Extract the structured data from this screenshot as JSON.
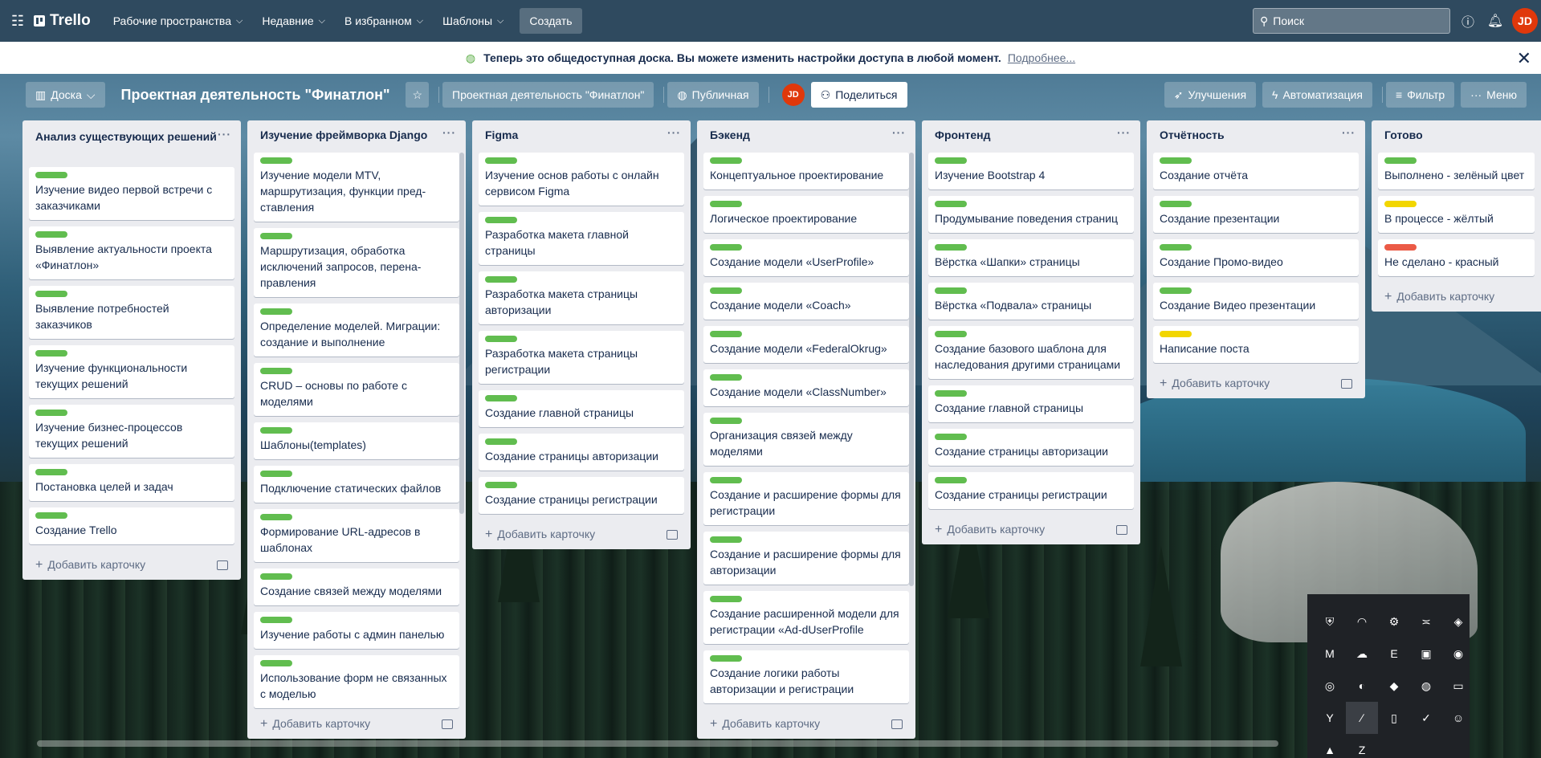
{
  "topnav": {
    "logo": "Trello",
    "menus": [
      "Рабочие пространства",
      "Недавние",
      "В избранном",
      "Шаблоны"
    ],
    "create": "Создать",
    "search_placeholder": "Поиск",
    "avatar": "JD"
  },
  "banner": {
    "text": "Теперь это общедоступная доска. Вы можете изменить настройки доступа в любой момент.",
    "link": "Подробнее..."
  },
  "board": {
    "view": "Доска",
    "title": "Проектная деятельность \"Финатлон\"",
    "workspace": "Проектная деятельность \"Финатлон\"",
    "visibility": "Публичная",
    "avatar": "JD",
    "share": "Поделиться",
    "powerups": "Улучшения",
    "automation": "Автоматизация",
    "filter": "Фильтр",
    "menu": "Меню"
  },
  "add_card": "Добавить карточку",
  "colors": {
    "green": "#61bd4f",
    "yellow": "#f2d600",
    "red": "#eb5a46",
    "brand_red": "#e0380b"
  },
  "lists": [
    {
      "title": "Анализ существующих решений",
      "cards": [
        {
          "text": "Изучение видео первой встречи с заказчиками",
          "label": "green"
        },
        {
          "text": "Выявление актуальности проекта «Финатлон»",
          "label": "green"
        },
        {
          "text": "Выявление потребностей заказчиков",
          "label": "green"
        },
        {
          "text": "Изучение функциональности текущих решений",
          "label": "green"
        },
        {
          "text": "Изучение бизнес-процессов текущих решений",
          "label": "green"
        },
        {
          "text": "Постановка целей и задач",
          "label": "green"
        },
        {
          "text": "Создание Trello",
          "label": "green"
        }
      ]
    },
    {
      "title": "Изучение фреймворка Django",
      "cards": [
        {
          "text": "Изучение модели MTV, маршрутизация, функции пред-ставления",
          "label": "green"
        },
        {
          "text": "Маршрутизация, обработка исключений запросов, перена-правления",
          "label": "green"
        },
        {
          "text": "Определение моделей. Миграции: создание и выполнение",
          "label": "green"
        },
        {
          "text": "CRUD – основы по работе с моделями",
          "label": "green"
        },
        {
          "text": "Шаблоны(templates)",
          "label": "green"
        },
        {
          "text": "Подключение статических файлов",
          "label": "green"
        },
        {
          "text": "Формирование URL-адресов в шаблонах",
          "label": "green"
        },
        {
          "text": "Создание связей между моделями",
          "label": "green"
        },
        {
          "text": "Изучение работы с админ панелью",
          "label": "green"
        },
        {
          "text": "Использование форм не связанных с моделью",
          "label": "green"
        },
        {
          "text": "",
          "label": "green"
        }
      ]
    },
    {
      "title": "Figma",
      "cards": [
        {
          "text": "Изучение основ работы с онлайн сервисом Figma",
          "label": "green"
        },
        {
          "text": "Разработка макета главной страницы",
          "label": "green"
        },
        {
          "text": "Разработка макета страницы авторизации",
          "label": "green"
        },
        {
          "text": "Разработка макета страницы регистрации",
          "label": "green"
        },
        {
          "text": "Создание главной страницы",
          "label": "green"
        },
        {
          "text": "Создание страницы авторизации",
          "label": "green"
        },
        {
          "text": "Создание страницы регистрации",
          "label": "green"
        }
      ]
    },
    {
      "title": "Бэкенд",
      "cards": [
        {
          "text": "Концептуальное проектирование",
          "label": "green"
        },
        {
          "text": "Логическое проектирование",
          "label": "green"
        },
        {
          "text": "Создание модели «UserProfile»",
          "label": "green"
        },
        {
          "text": "Создание модели «Coach»",
          "label": "green"
        },
        {
          "text": "Создание модели «FederalOkrug»",
          "label": "green"
        },
        {
          "text": "Создание модели «ClassNumber»",
          "label": "green"
        },
        {
          "text": "Организация связей между моделями",
          "label": "green"
        },
        {
          "text": "Создание и расширение формы для регистрации",
          "label": "green"
        },
        {
          "text": "Создание и расширение формы для авторизации",
          "label": "green"
        },
        {
          "text": "Создание расширенной модели для регистрации «Ad-dUserProfile",
          "label": "green"
        },
        {
          "text": "Создание логики работы авторизации и регистрации",
          "label": "green"
        },
        {
          "text": "",
          "label": "green"
        }
      ]
    },
    {
      "title": "Фронтенд",
      "cards": [
        {
          "text": "Изучение Bootstrap 4",
          "label": "green"
        },
        {
          "text": "Продумывание поведения страниц",
          "label": "green"
        },
        {
          "text": "Вёрстка «Шапки» страницы",
          "label": "green"
        },
        {
          "text": "Вёрстка «Подвала» страницы",
          "label": "green"
        },
        {
          "text": "Создание базового шаблона для наследования другими страницами",
          "label": "green"
        },
        {
          "text": "Создание главной страницы",
          "label": "green"
        },
        {
          "text": "Создание страницы авторизации",
          "label": "green"
        },
        {
          "text": "Создание страницы регистрации",
          "label": "green"
        }
      ]
    },
    {
      "title": "Отчётность",
      "cards": [
        {
          "text": "Создание отчёта",
          "label": "green"
        },
        {
          "text": "Создание презентации",
          "label": "green"
        },
        {
          "text": "Создание Промо-видео",
          "label": "green"
        },
        {
          "text": "Создание Видео презентации",
          "label": "green"
        },
        {
          "text": "Написание поста",
          "label": "yellow"
        }
      ]
    },
    {
      "title": "Готово",
      "cards": [
        {
          "text": "Выполнено - зелёный цвет",
          "label": "green"
        },
        {
          "text": "В процессе - жёлтый",
          "label": "yellow"
        },
        {
          "text": "Не сделано - красный",
          "label": "red"
        }
      ]
    }
  ],
  "tray_icons": [
    "shield-icon",
    "wifi-icon",
    "steam-icon",
    "sx-icon",
    "cube-icon",
    "malwarebytes-icon",
    "cloud-x-icon",
    "epic-icon",
    "device-icon",
    "chrome-icon",
    "discover-icon",
    "nvidia-icon",
    "launcher-icon",
    "origin-icon",
    "monitor-icon",
    "yandex-icon",
    "feather-icon",
    "usb-icon",
    "shield-check-icon",
    "discord-icon",
    "drive-icon",
    "zotero-icon"
  ]
}
